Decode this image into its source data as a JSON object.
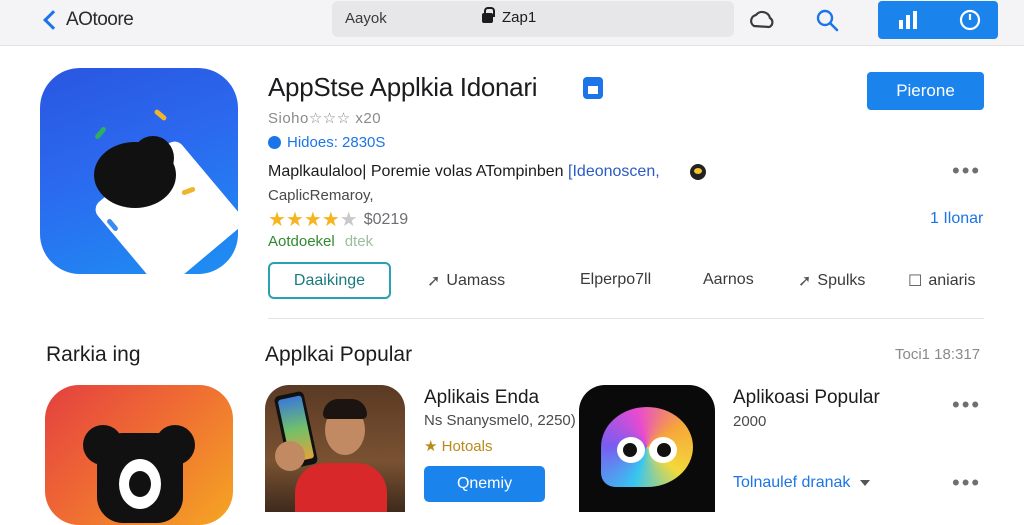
{
  "colors": {
    "accent": "#1a84ec",
    "link": "#1b75e8",
    "star": "#f4b521",
    "green": "#2e8b2e"
  },
  "topbar": {
    "back_label": "AOtoore",
    "site_label": "Aayok",
    "address": "Zap1",
    "icons": [
      "cloud-icon",
      "search-icon",
      "chart-icon",
      "clock-icon"
    ]
  },
  "app": {
    "title": "AppStse Applkia Idonari",
    "rating_line": "Sioho☆☆☆ x20",
    "meta": "Hidoes: 2830S",
    "description": "Maplkaulaloo| Poremie volas ATompinben",
    "description_link": "[Ideonoscen,",
    "category": "CaplicRemaroy,",
    "rating_value": 4,
    "rating_max": 5,
    "rating_count": "$0219",
    "green_label": "Aotdoekel",
    "green_faint": "dtek",
    "get_button": "Pierone",
    "side_link": "1 Ilonar"
  },
  "actions": {
    "primary": "Daaikinge",
    "items": [
      {
        "label": "Uamass",
        "icon": "share-arrow-icon"
      },
      {
        "label": "Elperpo7ll",
        "icon": ""
      },
      {
        "label": "Aarnos",
        "icon": ""
      },
      {
        "label": "Spulks",
        "icon": "forward-arrow-icon"
      },
      {
        "label": "aniaris",
        "icon": "comment-icon"
      }
    ]
  },
  "sections": {
    "ranking_title": "Rarkia ing",
    "popular_title": "Applkai Popular",
    "popular_meta": "Toci1 18:317"
  },
  "cards": [
    {
      "title": "Aplikais Enda",
      "sub": "Ns Snanysmel0, 2250)",
      "gold": "★ Hotoals",
      "button": "Qnemiy"
    },
    {
      "title": "Aplikoasi Popular",
      "sub": "2000",
      "dropdown": "Tolnaulef dranak"
    }
  ]
}
